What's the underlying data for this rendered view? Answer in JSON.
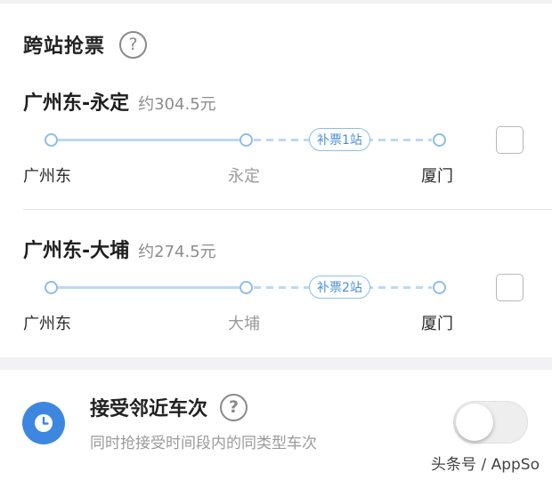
{
  "section": {
    "title": "跨站抢票",
    "help_glyph": "?"
  },
  "routes": [
    {
      "name": "广州东-永定",
      "price": "约304.5元",
      "badge": "补票1站",
      "stations": [
        "广州东",
        "永定",
        "厦门"
      ],
      "checked": false
    },
    {
      "name": "广州东-大埔",
      "price": "约274.5元",
      "badge": "补票2站",
      "stations": [
        "广州东",
        "大埔",
        "厦门"
      ],
      "checked": false
    }
  ],
  "option": {
    "title": "接受邻近车次",
    "help_glyph": "?",
    "description": "同时抢接受时间段内的同类型车次",
    "enabled": false,
    "icon": "clock-icon"
  },
  "watermark": "头条号 / AppSo",
  "colors": {
    "accent": "#4a90d9",
    "track": "#bcd8f3",
    "clock_bg": "#3d87e0"
  }
}
